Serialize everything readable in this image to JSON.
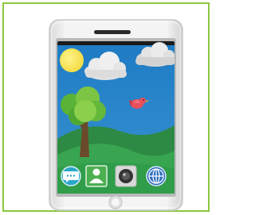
{
  "illustration": {
    "subject": "smartphone",
    "colors": {
      "frame_border": "#8cc63e",
      "phone_body": "#f0f0f0",
      "bezel_shadow": "#b9b9b9",
      "screen_black": "#1a1a1a",
      "sky": "#2f86c9",
      "sun": "#f6e34a",
      "cloud": "#e8e8e8",
      "hill_front": "#2f9c48",
      "hill_back": "#3aa055",
      "tree_foliage": "#6cbf3b",
      "tree_trunk": "#6b4a2c",
      "bird": "#e8505b",
      "dock": "#bfc6cc"
    },
    "dock_icons": [
      {
        "name": "chat-icon",
        "color": "#2aa7c9"
      },
      {
        "name": "contacts-icon",
        "color": "#4caf50"
      },
      {
        "name": "camera-icon",
        "color": "#333333"
      },
      {
        "name": "globe-icon",
        "color": "#2b6fc1"
      }
    ]
  }
}
